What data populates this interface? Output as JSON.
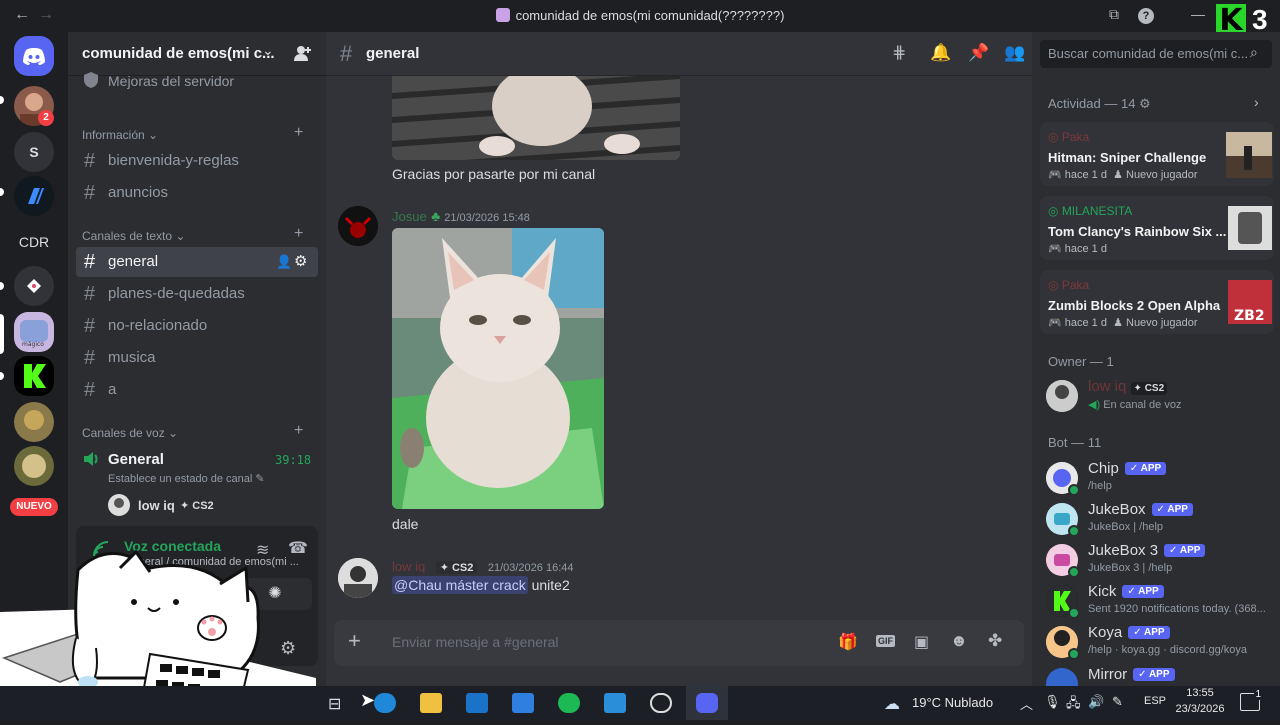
{
  "window": {
    "title": "comunidad de emos(mi comunidad(????????)",
    "overlay_brand": "K",
    "overlay_number": "3"
  },
  "rail": {
    "servers": [
      {
        "label": "",
        "badge": "2"
      },
      {
        "label": "S"
      },
      {
        "label": ""
      },
      {
        "label": "CDR"
      },
      {
        "label": ""
      },
      {
        "label": ""
      },
      {
        "label": ""
      },
      {
        "label": ""
      },
      {
        "label": ""
      }
    ],
    "new_badge": "NUEVO"
  },
  "sidebar": {
    "server_name": "comunidad de emos(mi c...",
    "top_item": "Mejoras del servidor",
    "categories": {
      "info": "Información",
      "text": "Canales de texto",
      "voice": "Canales de voz"
    },
    "info_channels": [
      "bienvenida-y-reglas",
      "anuncios"
    ],
    "text_channels": [
      "general",
      "planes-de-quedadas",
      "no-relacionado",
      "musica",
      "a"
    ],
    "voice_channel": {
      "name": "General",
      "timer": "39:18",
      "status": "Establece un estado de canal"
    },
    "voice_user": {
      "name": "low iq",
      "tag": "CS2"
    },
    "voice_panel": {
      "status": "Voz conectada",
      "location": "General / comunidad de emos(mi ..."
    }
  },
  "main": {
    "channel": "general",
    "messages": [
      {
        "text": "Gracias por pasarte por mi canal"
      },
      {
        "author": "Josue",
        "timestamp": "21/03/2026 15:48",
        "text": "dale"
      },
      {
        "author": "low iq",
        "tag": "CS2",
        "timestamp": "21/03/2026 16:44",
        "mention": "@Chau máster crack",
        "text": "unite2"
      }
    ],
    "composer_placeholder": "Enviar mensaje a #general"
  },
  "right": {
    "search_placeholder": "Buscar comunidad de emos(mi c...",
    "activity_title": "Actividad — 14",
    "activities": [
      {
        "user": "Paka",
        "game": "Hitman: Sniper Challenge",
        "time": "hace 1 d",
        "extra": "Nuevo jugador"
      },
      {
        "user": "MILANESITA",
        "game": "Tom Clancy's Rainbow Six ...",
        "time": "hace 1 d",
        "extra": ""
      },
      {
        "user": "Paka",
        "game": "Zumbi Blocks 2 Open Alpha",
        "time": "hace 1 d",
        "extra": "Nuevo jugador"
      }
    ],
    "owner_title": "Owner — 1",
    "owner": {
      "name": "low iq",
      "tag": "CS2",
      "status": "En canal de voz"
    },
    "bot_title": "Bot — 11",
    "app_label": "APP",
    "bots": [
      {
        "name": "Chip",
        "status": "/help"
      },
      {
        "name": "JukeBox",
        "status": "JukeBox | /help"
      },
      {
        "name": "JukeBox 3",
        "status": "JukeBox 3 | /help"
      },
      {
        "name": "Kick",
        "status": "Sent 1920 notifications today. (368..."
      },
      {
        "name": "Koya",
        "status": "/help · koya.gg · discord.gg/koya"
      },
      {
        "name": "Mirror",
        "status": ""
      }
    ]
  },
  "taskbar": {
    "weather": "19°C  Nublado",
    "lang": "ESP",
    "time": "13:55",
    "date": "23/3/2026",
    "notif": "1"
  },
  "colors": {
    "accent": "#5865f2",
    "online": "#23a55a",
    "kick": "#53fc18",
    "red": "#f23f43",
    "mention_bg": "#3c4270"
  }
}
